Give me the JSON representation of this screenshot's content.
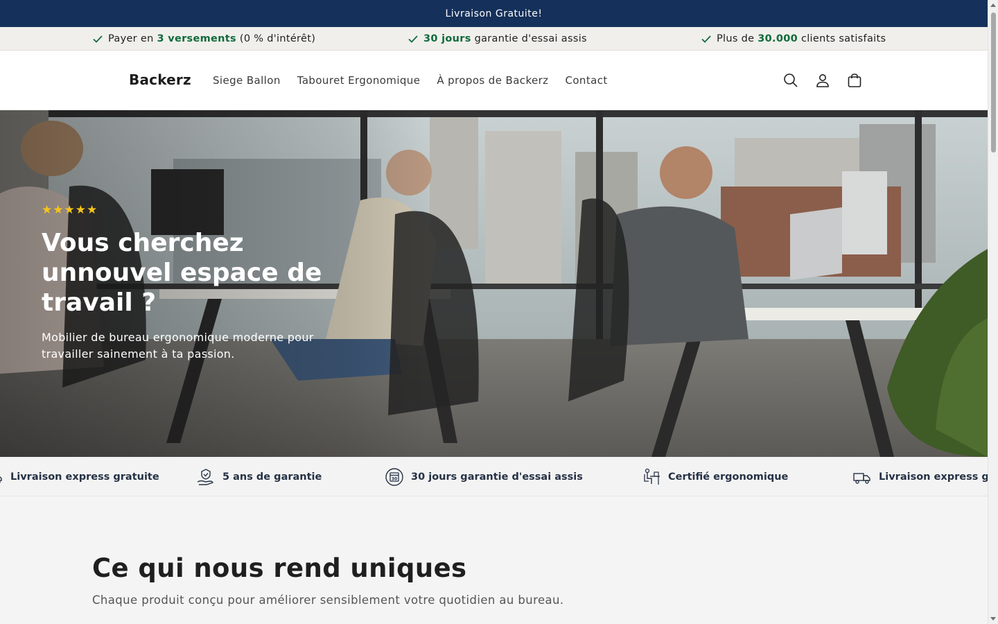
{
  "announcement": {
    "text": "Livraison Gratuite!"
  },
  "usp": [
    {
      "pre": "Payer en ",
      "highlight": "3 versements",
      "post": " (0 % d'intérêt)"
    },
    {
      "pre": "",
      "highlight": "30 jours",
      "post": " garantie d'essai assis"
    },
    {
      "pre": "Plus de ",
      "highlight": "30.000",
      "post": " clients satisfaits"
    }
  ],
  "header": {
    "logo": "Backerz",
    "nav": [
      "Siege Ballon",
      "Tabouret Ergonomique",
      "À propos de Backerz",
      "Contact"
    ],
    "icons": [
      "search-icon",
      "account-icon",
      "cart-icon"
    ]
  },
  "hero": {
    "stars": "★★★★★",
    "title": "Vous cherchez unnouvel espace de travail ?",
    "subtitle": "Mobilier de bureau ergonomique moderne pour travailler sainement à ta passion."
  },
  "features": [
    {
      "label": "Livraison express gratuite",
      "icon": "truck-icon"
    },
    {
      "label": "5 ans de garantie",
      "icon": "warranty-hand-icon"
    },
    {
      "label": "30 jours garantie d'essai assis",
      "icon": "calendar-icon"
    },
    {
      "label": "Certifié ergonomique",
      "icon": "desk-person-icon"
    },
    {
      "label": "Livraison express gratuite",
      "icon": "truck-icon"
    }
  ],
  "section": {
    "title": "Ce qui nous rend uniques",
    "subtitle": "Chaque produit conçu pour améliorer sensiblement votre quotidien au bureau."
  },
  "colors": {
    "announcement_bg": "#15305a",
    "accent_green": "#0f6b3c",
    "stars": "#f5c518"
  }
}
